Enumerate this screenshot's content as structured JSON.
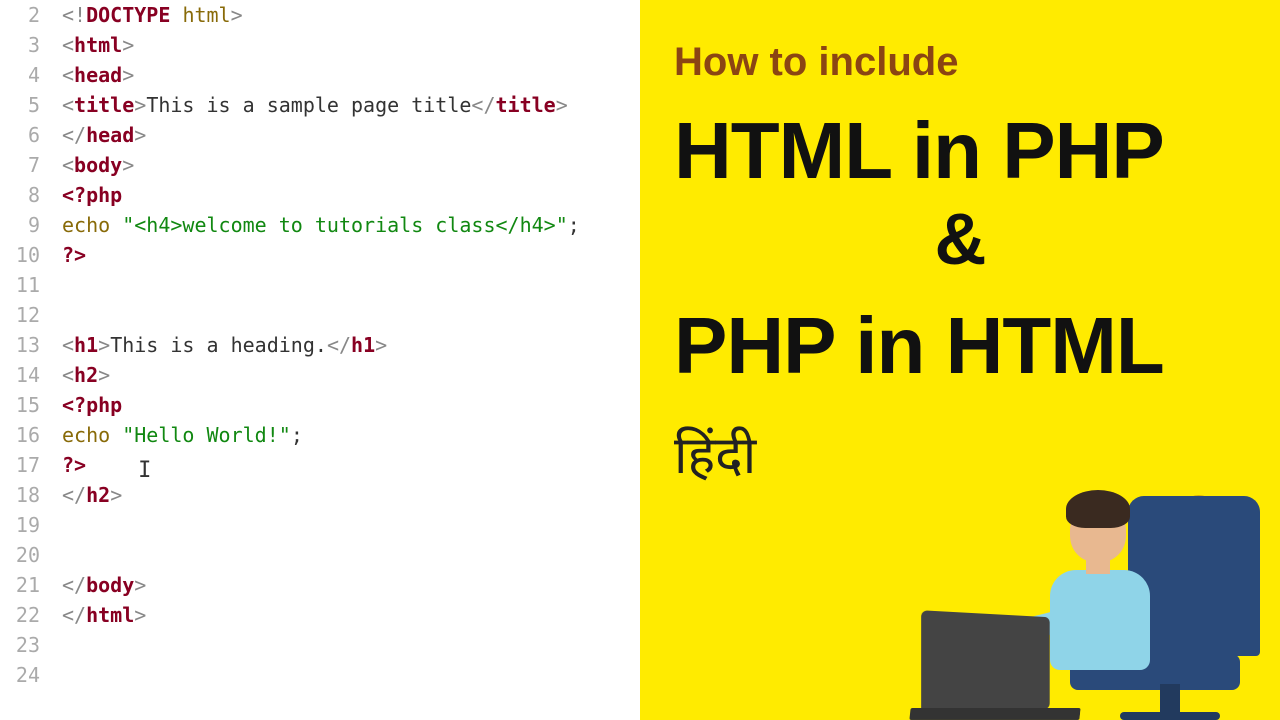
{
  "lines": {
    "start": 2,
    "end": 24
  },
  "code": {
    "l2": {
      "o": "<!",
      "k": "DOCTYPE",
      "sp": " ",
      "a": "html",
      "c": ">"
    },
    "l3": {
      "o": "<",
      "k": "html",
      "c": ">"
    },
    "l4": {
      "o": "<",
      "k": "head",
      "c": ">"
    },
    "l5": {
      "o1": "<",
      "k1": "title",
      "c1": ">",
      "t": "This is a sample page title",
      "o2": "</",
      "k2": "title",
      "c2": ">"
    },
    "l6": {
      "o": "</",
      "k": "head",
      "c": ">"
    },
    "l7": {
      "o": "<",
      "k": "body",
      "c": ">"
    },
    "l8": {
      "t": "<?php"
    },
    "l9": {
      "e": "echo ",
      "q1": "\"",
      "s": "<h4>welcome to tutorials class</h4>",
      "q2": "\"",
      "sc": ";"
    },
    "l10": {
      "t": "?>"
    },
    "l13": {
      "o1": "<",
      "k1": "h1",
      "c1": ">",
      "t": "This is a heading.",
      "o2": "</",
      "k2": "h1",
      "c2": ">"
    },
    "l14": {
      "o": "<",
      "k": "h2",
      "c": ">"
    },
    "l15": {
      "t": "<?php"
    },
    "l16": {
      "e": "echo ",
      "q1": "\"",
      "s": "Hello World!",
      "q2": "\"",
      "sc": ";"
    },
    "l17": {
      "t": "?>"
    },
    "l18": {
      "o": "</",
      "k": "h2",
      "c": ">"
    },
    "l21": {
      "o": "</",
      "k": "body",
      "c": ">"
    },
    "l22": {
      "o": "</",
      "k": "html",
      "c": ">"
    }
  },
  "promo": {
    "sub": "How to include",
    "l1": "HTML in PHP",
    "amp": "&",
    "l2": "PHP in HTML",
    "hindi": "हिंदी",
    "qm": "?"
  }
}
